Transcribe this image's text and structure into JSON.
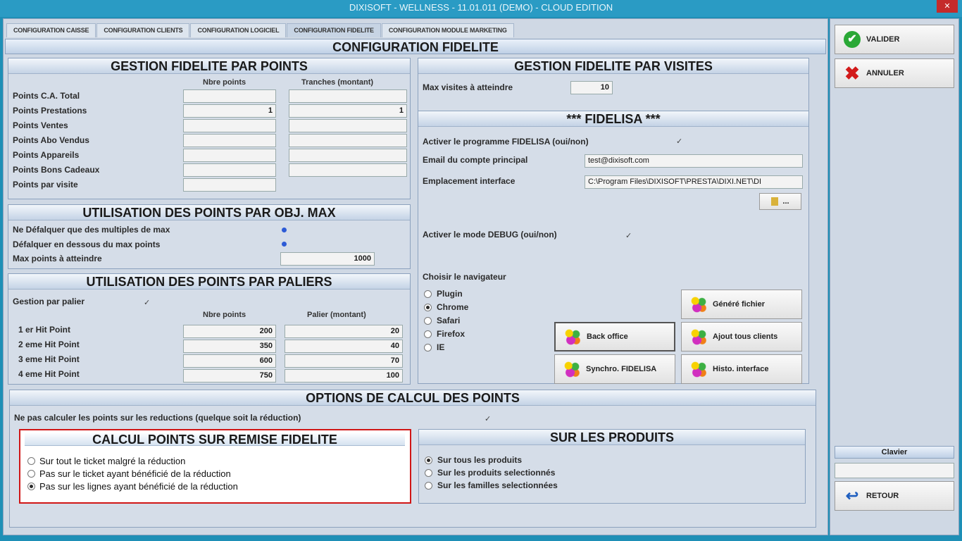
{
  "window": {
    "title": "DIXISOFT - WELLNESS - 11.01.011 (DEMO) - CLOUD EDITION",
    "close_label": "✕"
  },
  "tabs": [
    "CONFIGURATION CAISSE",
    "CONFIGURATION CLIENTS",
    "CONFIGURATION LOGICIEL",
    "CONFIGURATION FIDELITE",
    "CONFIGURATION MODULE MARKETING"
  ],
  "page_title": "CONFIGURATION FIDELITE",
  "gestion_points": {
    "title": "GESTION FIDELITE PAR POINTS",
    "col1": "Nbre points",
    "col2": "Tranches (montant)",
    "rows": [
      {
        "label": "Points C.A. Total",
        "v1": "",
        "v2": ""
      },
      {
        "label": "Points Prestations",
        "v1": "1",
        "v2": "1"
      },
      {
        "label": "Points Ventes",
        "v1": "",
        "v2": ""
      },
      {
        "label": "Points Abo Vendus",
        "v1": "",
        "v2": ""
      },
      {
        "label": "Points Appareils",
        "v1": "",
        "v2": ""
      },
      {
        "label": "Points Bons Cadeaux",
        "v1": "",
        "v2": ""
      },
      {
        "label": "Points par visite",
        "v1": ""
      }
    ]
  },
  "utilisation_obj": {
    "title": "UTILISATION DES POINTS PAR OBJ. MAX",
    "opt1": "Ne Défalquer que des multiples de max",
    "opt2": "Défalquer en dessous du max points",
    "max_label": "Max points à atteindre",
    "max_value": "1000"
  },
  "paliers": {
    "title": "UTILISATION DES POINTS PAR PALIERS",
    "gestion_label": "Gestion par palier",
    "col1": "Nbre points",
    "col2": "Palier (montant)",
    "rows": [
      {
        "label": "1 er Hit Point",
        "v1": "200",
        "v2": "20"
      },
      {
        "label": "2 eme Hit Point",
        "v1": "350",
        "v2": "40"
      },
      {
        "label": "3 eme Hit Point",
        "v1": "600",
        "v2": "70"
      },
      {
        "label": "4 eme Hit Point",
        "v1": "750",
        "v2": "100"
      }
    ]
  },
  "visites": {
    "title": "GESTION FIDELITE PAR VISITES",
    "label": "Max visites à atteindre",
    "value": "10"
  },
  "fidelisa": {
    "title": "*** FIDELISA ***",
    "activer_label": "Activer le programme FIDELISA (oui/non)",
    "email_label": "Email du compte principal",
    "email_value": "test@dixisoft.com",
    "emplacement_label": "Emplacement interface",
    "emplacement_value": "C:\\Program Files\\DIXISOFT\\PRESTA\\DIXI.NET\\DI",
    "browse_label": "...",
    "debug_label": "Activer le mode DEBUG (oui/non)",
    "nav_label": "Choisir le navigateur",
    "navs": [
      "Plugin",
      "Chrome",
      "Safari",
      "Firefox",
      "IE"
    ],
    "btn_genere": "Généré fichier",
    "btn_back": "Back office",
    "btn_ajout": "Ajout tous clients",
    "btn_synchro": "Synchro. FIDELISA",
    "btn_histo": "Histo. interface"
  },
  "options": {
    "title": "OPTIONS DE CALCUL DES POINTS",
    "no_reduc_label": "Ne pas calculer les points sur les reductions (quelque soit la réduction)"
  },
  "remise": {
    "title": "CALCUL POINTS SUR REMISE FIDELITE",
    "opt1": "Sur tout le ticket malgré la réduction",
    "opt2": "Pas sur le ticket ayant bénéficié de la réduction",
    "opt3": "Pas sur les lignes ayant bénéficié de la réduction"
  },
  "produits": {
    "title": "SUR LES PRODUITS",
    "opt1": "Sur tous les produits",
    "opt2": "Sur les produits selectionnés",
    "opt3": "Sur les familles selectionnées"
  },
  "side": {
    "valider": "VALIDER",
    "annuler": "ANNULER",
    "clavier": "Clavier",
    "retour": "RETOUR"
  }
}
